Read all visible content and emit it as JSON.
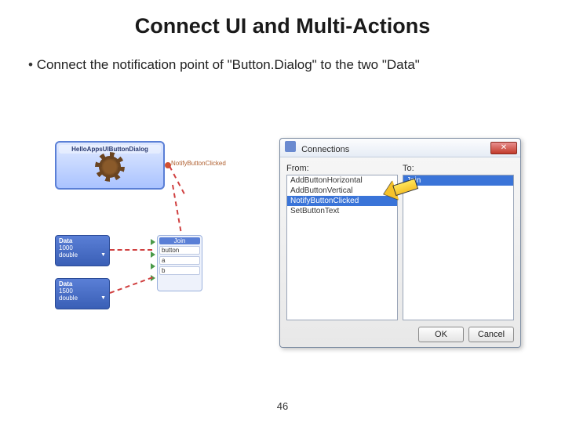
{
  "title": "Connect UI and Multi-Actions",
  "bullet": "Connect the notification point of \"Button.Dialog\" to the two \"Data\"",
  "page_number": "46",
  "diagram": {
    "dialog_node_title": "HelloAppsUIButtonDialog",
    "notify_label": "NotifyButtonClicked",
    "data_label": "Data",
    "data1_value": "1000",
    "data2_value": "1500",
    "data_type": "double",
    "join_label": "Join",
    "join_slots": [
      "button",
      "a",
      "b"
    ]
  },
  "dialog": {
    "title": "Connections",
    "from_label": "From:",
    "to_label": "To:",
    "from_items": [
      "AddButtonHorizontal",
      "AddButtonVertical",
      "NotifyButtonClicked",
      "SetButtonText"
    ],
    "from_selected_index": 2,
    "to_items": [
      "Join"
    ],
    "to_selected_index": 0,
    "ok_label": "OK",
    "cancel_label": "Cancel",
    "close_glyph": "✕"
  }
}
